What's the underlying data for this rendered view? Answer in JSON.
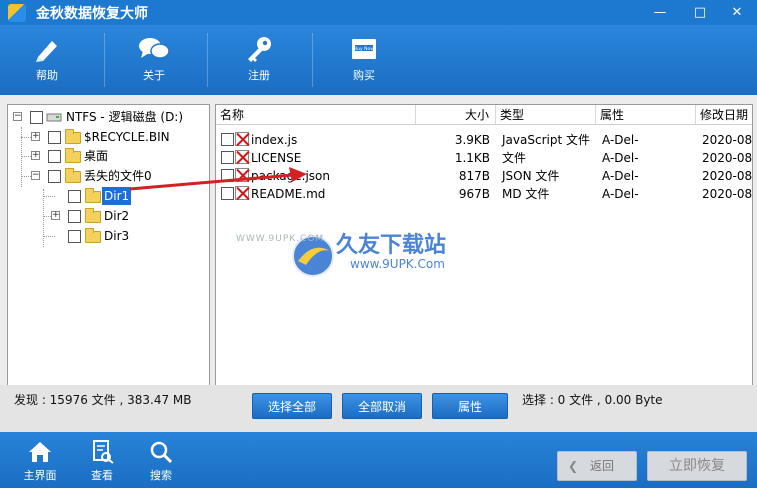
{
  "window": {
    "title": "金秋数据恢复大师",
    "controls": {
      "minimize": "—",
      "maximize": "□",
      "close": "✕"
    }
  },
  "toolbar": {
    "items": [
      {
        "label": "帮助",
        "icon": "pen-icon"
      },
      {
        "label": "关于",
        "icon": "chat-bubbles-icon"
      },
      {
        "label": "注册",
        "icon": "key-icon"
      },
      {
        "label": "购买",
        "icon": "shop-card-icon",
        "icon_caption": "Buy Now"
      }
    ]
  },
  "tree": {
    "nodes": [
      {
        "label": "NTFS - 逻辑磁盘 (D:)",
        "icon": "drive-icon"
      },
      {
        "label": "$RECYCLE.BIN"
      },
      {
        "label": "桌面"
      },
      {
        "label": "丢失的文件0"
      },
      {
        "label": "Dir1",
        "selected": true
      },
      {
        "label": "Dir2"
      },
      {
        "label": "Dir3"
      }
    ]
  },
  "file_list": {
    "columns": [
      "名称",
      "大小",
      "类型",
      "属性",
      "修改日期"
    ],
    "rows": [
      {
        "name": "index.js",
        "size": "3.9KB",
        "type": "JavaScript 文件",
        "attr": "A-Del-",
        "date": "2020-08-"
      },
      {
        "name": "LICENSE",
        "size": "1.1KB",
        "type": "文件",
        "attr": "A-Del-",
        "date": "2020-08-"
      },
      {
        "name": "package.json",
        "size": "817B",
        "type": "JSON 文件",
        "attr": "A-Del-",
        "date": "2020-08-"
      },
      {
        "name": "README.md",
        "size": "967B",
        "type": "MD 文件",
        "attr": "A-Del-",
        "date": "2020-08-"
      }
    ]
  },
  "watermark": {
    "brand": "久友下载站",
    "url_top": "WWW.9UPK.COM",
    "url": "www.9UPK.Com"
  },
  "status": {
    "found": "发现 : 15976 文件 , 383.47 MB",
    "select_all": "选择全部",
    "deselect_all": "全部取消",
    "properties": "属性",
    "selected": "选择 : 0 文件 , 0.00 Byte"
  },
  "bottom": {
    "items": [
      {
        "label": "主界面",
        "icon": "home-icon"
      },
      {
        "label": "查看",
        "icon": "document-view-icon"
      },
      {
        "label": "搜索",
        "icon": "search-icon"
      }
    ],
    "back": "返回",
    "back_arrow": "❮",
    "recover": "立即恢复"
  },
  "colors": {
    "titlebar": "#1d78cf",
    "toolbar": "#2380d6",
    "selection": "#1c6fd6",
    "deleted_mark": "#d01818",
    "folder": "#f3d15a",
    "arrow": "#d42020"
  }
}
